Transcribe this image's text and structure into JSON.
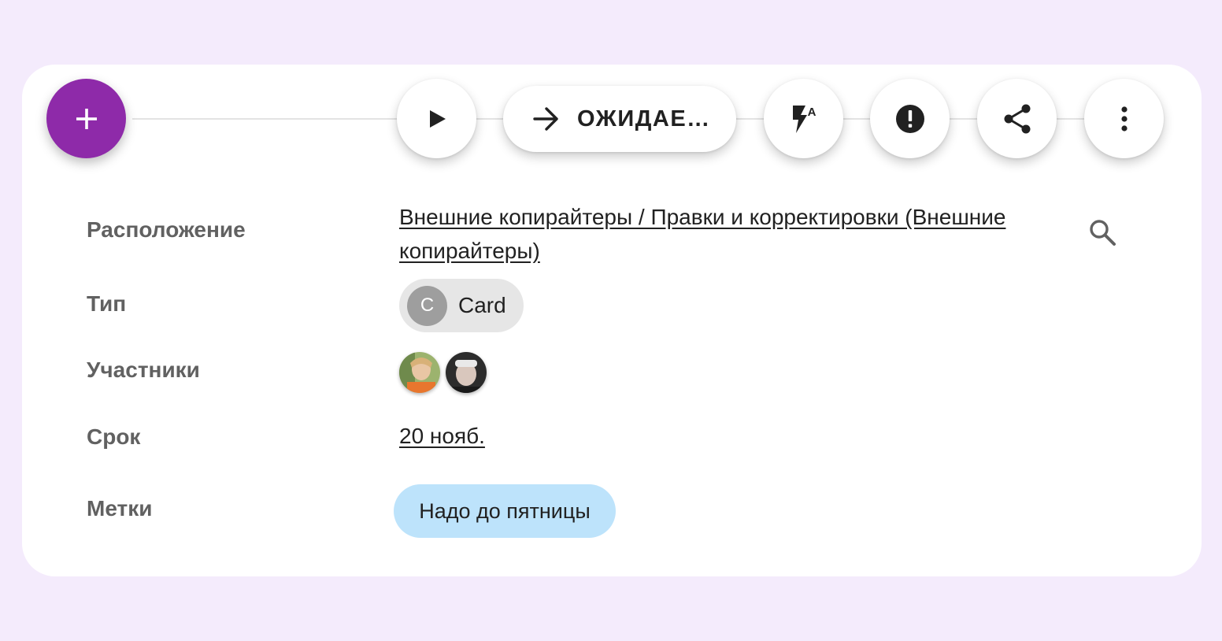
{
  "toolbar": {
    "add_icon": "plus-icon",
    "play_icon": "play-icon",
    "status": {
      "icon": "arrow-right-icon",
      "label": "ОЖИДАЕ…"
    },
    "automation_icon": "flash-auto-icon",
    "automation_letter": "A",
    "priority_icon": "alert-circle-icon",
    "share_icon": "share-icon",
    "more_icon": "more-vertical-icon"
  },
  "fields": {
    "location": {
      "label": "Расположение",
      "value": "Внешние копирайтеры / Правки и корректировки (Внешние копирайтеры)",
      "search_icon": "search-icon"
    },
    "type": {
      "label": "Тип",
      "avatar_letter": "C",
      "value": "Card"
    },
    "members": {
      "label": "Участники",
      "count": 2
    },
    "due": {
      "label": "Срок",
      "value": "20 нояб."
    },
    "tags": {
      "label": "Метки",
      "items": [
        "Надо до пятницы"
      ]
    }
  },
  "colors": {
    "background": "#f4ebfc",
    "fab": "#8e2aa9",
    "tag_chip": "#bde3fb",
    "type_chip": "#e6e6e6",
    "label_text": "#616161"
  }
}
